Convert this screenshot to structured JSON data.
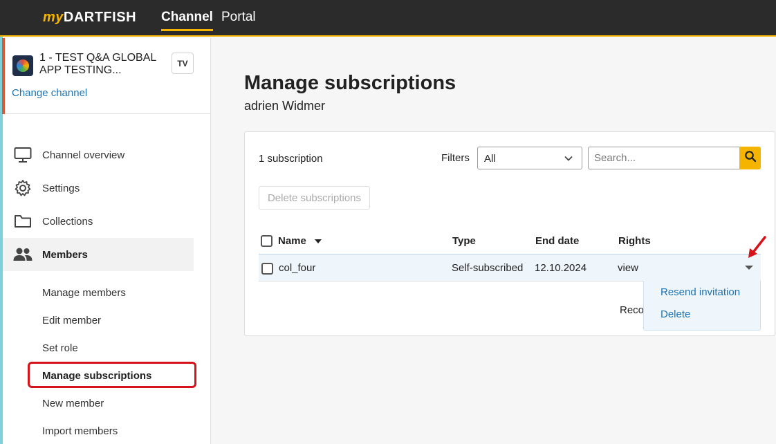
{
  "topbar": {
    "logo_my": "my",
    "logo_brand": "DARTFISH",
    "tabs": [
      {
        "label": "Channel",
        "active": true
      },
      {
        "label": "Portal",
        "active": false
      }
    ],
    "accent_color": "#f5b400"
  },
  "sidebar": {
    "channel": {
      "name": "1 - TEST Q&A GLOBAL APP TESTING...",
      "badge": "TV",
      "change_label": "Change channel"
    },
    "menu": [
      {
        "label": "Channel overview",
        "icon": "monitor-icon"
      },
      {
        "label": "Settings",
        "icon": "gear-icon"
      },
      {
        "label": "Collections",
        "icon": "folder-icon"
      },
      {
        "label": "Members",
        "icon": "users-icon",
        "active": true
      }
    ],
    "submenu": [
      {
        "label": "Manage members"
      },
      {
        "label": "Edit member"
      },
      {
        "label": "Set role"
      },
      {
        "label": "Manage subscriptions",
        "active": true
      },
      {
        "label": "New member"
      },
      {
        "label": "Import members"
      }
    ]
  },
  "main": {
    "title": "Manage subscriptions",
    "subtitle": "adrien Widmer",
    "count": "1 subscription",
    "filters_label": "Filters",
    "filter_value": "All",
    "search_placeholder": "Search...",
    "delete_button": "Delete subscriptions",
    "columns": [
      "Name",
      "Type",
      "End date",
      "Rights"
    ],
    "rows": [
      {
        "name": "col_four",
        "type": "Self-subscribed",
        "end_date": "12.10.2024",
        "rights": "view"
      }
    ],
    "footer_partial": "Reco",
    "row_menu": [
      "Resend invitation",
      "Delete"
    ]
  }
}
